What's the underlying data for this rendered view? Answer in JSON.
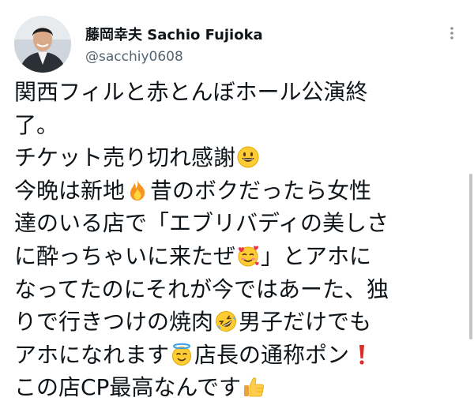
{
  "user": {
    "display_name": "藤岡幸夫 Sachio Fujioka",
    "handle": "@sacchiy0608"
  },
  "tweet": {
    "lines": [
      "関西フィルと赤とんぼホール公演終",
      "了。",
      "チケット売り切れ感謝",
      "今晩は新地",
      "昔のボクだったら女性",
      "達のいる店で「エブリバディの美しさ",
      "に酔っちゃいに来たぜ",
      "」とアホに",
      "なってたのにそれが今ではあーた、独",
      "りで行きつけの焼肉",
      "男子だけでも",
      "アホになれます",
      "店長の通称ポン",
      "この店CP最高なんです"
    ]
  },
  "icons": {
    "more": "more-dots-icon",
    "grin": "grinning-face-emoji",
    "fire": "fire-emoji",
    "hearts": "smiling-face-with-hearts-emoji",
    "rofl": "rolling-on-floor-laughing-emoji",
    "halo": "smiling-face-with-halo-emoji",
    "exclaim": "red-exclamation-emoji",
    "thumbs": "thumbs-up-emoji"
  },
  "colors": {
    "text": "#0f1419",
    "secondary": "#536471",
    "background": "#ffffff"
  }
}
